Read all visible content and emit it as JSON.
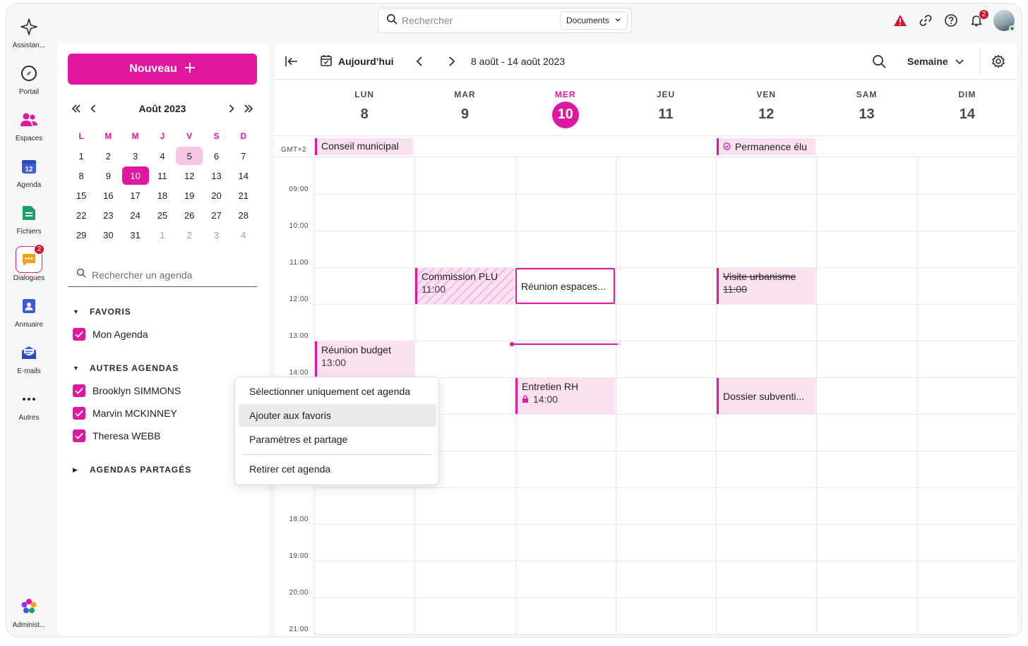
{
  "rail": {
    "items": [
      {
        "label": "Assistan...",
        "icon": "sparkle-icon"
      },
      {
        "label": "Portail",
        "icon": "compass-icon"
      },
      {
        "label": "Espaces",
        "icon": "people-icon"
      },
      {
        "label": "Agenda",
        "icon": "calendar-icon",
        "day": "12"
      },
      {
        "label": "Fichiers",
        "icon": "file-icon"
      },
      {
        "label": "Dialogues",
        "icon": "chat-icon",
        "badge": "2"
      },
      {
        "label": "Annuaire",
        "icon": "contact-book-icon"
      },
      {
        "label": "E-mails",
        "icon": "mail-icon"
      },
      {
        "label": "Autres",
        "icon": "more-icon"
      },
      {
        "label": "Administ...",
        "icon": "admin-flower-icon"
      }
    ]
  },
  "topbar": {
    "search_placeholder": "Rechercher",
    "scope": "Documents",
    "notifications_badge": "2"
  },
  "sidebar": {
    "new_button": "Nouveau",
    "mini_month": "Août 2023",
    "weekdays": [
      "L",
      "M",
      "M",
      "J",
      "V",
      "S",
      "D"
    ],
    "weeks": [
      [
        "1",
        "2",
        "3",
        "4",
        "5",
        "6",
        "7"
      ],
      [
        "8",
        "9",
        "10",
        "11",
        "12",
        "13",
        "14"
      ],
      [
        "15",
        "16",
        "17",
        "18",
        "19",
        "20",
        "21"
      ],
      [
        "22",
        "23",
        "24",
        "25",
        "26",
        "27",
        "28"
      ],
      [
        "29",
        "30",
        "31",
        "1",
        "2",
        "3",
        "4"
      ]
    ],
    "agenda_search_placeholder": "Rechercher un agenda",
    "favorites_title": "FAVORIS",
    "favorites": [
      "Mon Agenda"
    ],
    "others_title": "AUTRES AGENDAS",
    "others": [
      "Brooklyn SIMMONS",
      "Marvin MCKINNEY",
      "Theresa WEBB"
    ],
    "shared_title": "AGENDAS PARTAGÉS"
  },
  "toolbar": {
    "today_label": "Aujourd’hui",
    "range_label": "8 août - 14 août 2023",
    "view_label": "Semaine"
  },
  "week": {
    "days": [
      {
        "dow": "LUN",
        "num": "8"
      },
      {
        "dow": "MAR",
        "num": "9"
      },
      {
        "dow": "MER",
        "num": "10",
        "today": true
      },
      {
        "dow": "JEU",
        "num": "11"
      },
      {
        "dow": "VEN",
        "num": "12"
      },
      {
        "dow": "SAM",
        "num": "13"
      },
      {
        "dow": "DIM",
        "num": "14"
      }
    ],
    "timezone": "GMT+2",
    "hours": [
      "09:00",
      "10:00",
      "11:00",
      "12:00",
      "13:00",
      "14:00",
      "18:00",
      "19:00",
      "20:00",
      "21:00"
    ]
  },
  "events": {
    "allday_1": "Conseil municipal",
    "allday_2": "Permanence élu",
    "commission": {
      "title": "Commission PLU",
      "time": "11:00"
    },
    "reunion_espaces": {
      "title": "Réunion espaces..."
    },
    "visite": {
      "title": "Visite urbanisme",
      "time": "11:00"
    },
    "budget": {
      "title": "Réunion budget",
      "time": "13:00"
    },
    "entretien": {
      "title": "Entretien RH",
      "time": "14:00"
    },
    "dossier": {
      "title": "Dossier subventi..."
    }
  },
  "context_menu": {
    "items": [
      "Sélectionner uniquement cet agenda",
      "Ajouter aux favoris",
      "Paramètres et partage",
      "Retirer cet agenda"
    ]
  },
  "colors": {
    "accent": "#e0189f",
    "accent_light": "#fce1f1",
    "alert": "#d4122c"
  }
}
